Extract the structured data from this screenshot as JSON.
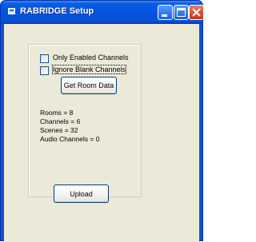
{
  "window": {
    "title": "RABRIDGE Setup"
  },
  "options": {
    "only_enabled_label": "Only Enabled Channels",
    "only_enabled_checked": false,
    "ignore_blank_label": "Ignore Blank Channels",
    "ignore_blank_checked": false
  },
  "buttons": {
    "get_room_data": "Get Room Data",
    "upload": "Upload"
  },
  "stats": {
    "rooms": "Rooms = 8",
    "channels": "Channels = 6",
    "scenes": "Scenes = 32",
    "audio_channels": "Audio Channels = 0"
  },
  "colors": {
    "titlebar": "#0553e0",
    "client_background": "#ece9d8",
    "close_button": "#c7331b"
  },
  "icons": {
    "app": "app-window-icon",
    "minimize": "minimize-icon",
    "maximize": "maximize-icon",
    "close": "close-icon"
  }
}
